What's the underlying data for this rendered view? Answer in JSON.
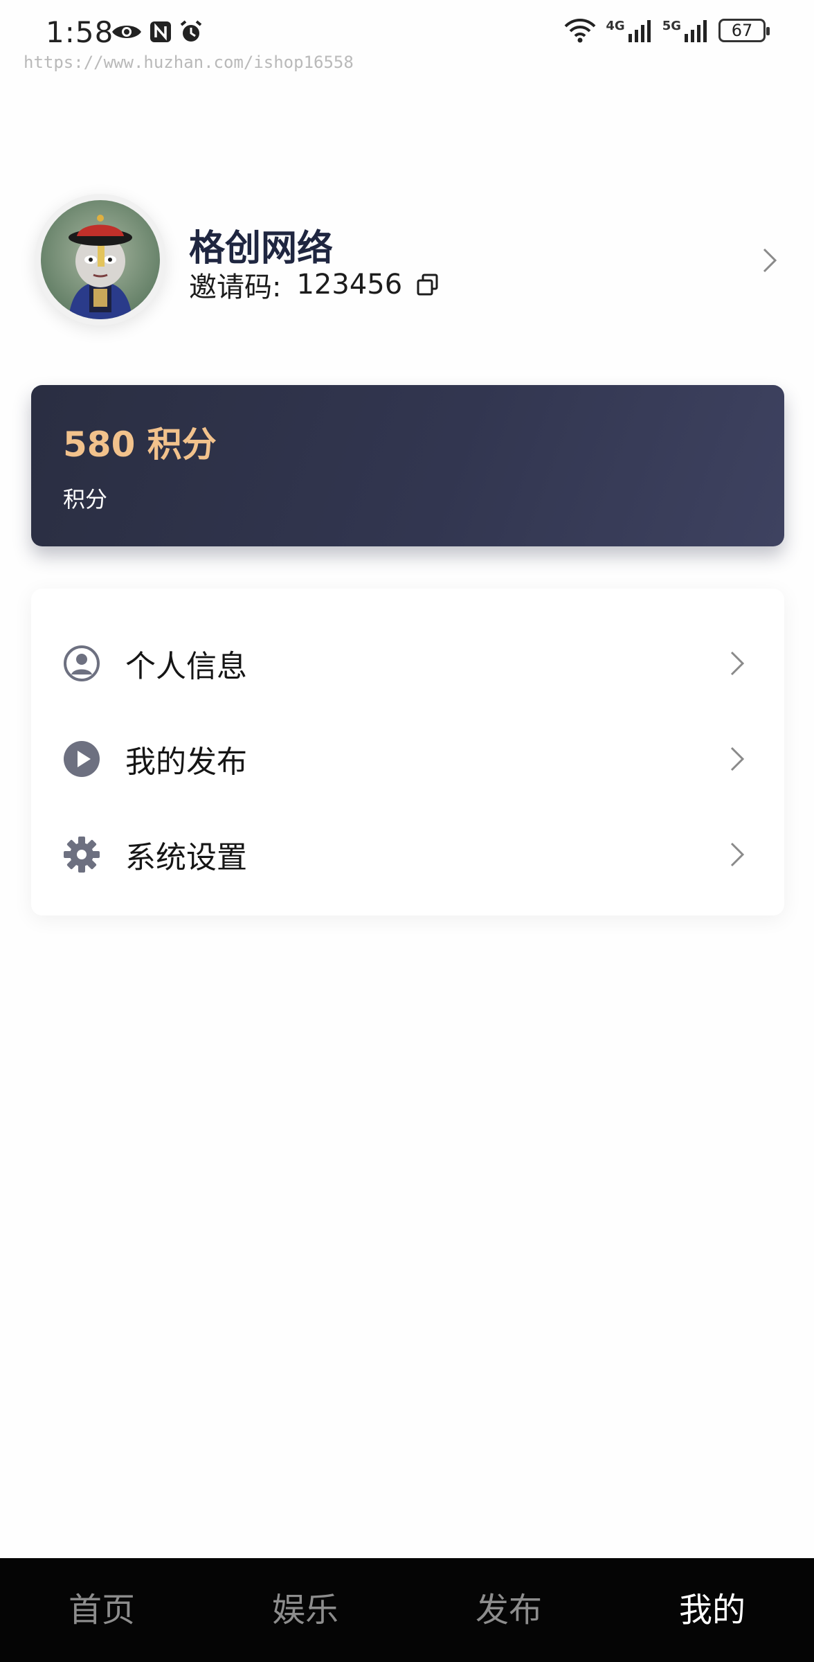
{
  "status_bar": {
    "time": "1:58",
    "net_4g": "4G",
    "net_5g": "5G",
    "battery": "67",
    "watermark": "https://www.huzhan.com/ishop16558",
    "icons": [
      "eye-icon",
      "nfc-icon",
      "alarm-icon",
      "wifi-icon",
      "signal-icon",
      "battery-icon"
    ]
  },
  "profile": {
    "name": "格创网络",
    "invite_label": "邀请码:",
    "invite_code": "123456",
    "avatar": "qing-zombie-avatar"
  },
  "points_card": {
    "value": "580 积分",
    "label": "积分",
    "value_color": "#f2c28c"
  },
  "menu": {
    "items": [
      {
        "label": "个人信息",
        "icon": "user-circle-icon"
      },
      {
        "label": "我的发布",
        "icon": "play-circle-icon"
      },
      {
        "label": "系统设置",
        "icon": "gear-icon"
      }
    ]
  },
  "tab_bar": {
    "tabs": [
      {
        "label": "首页"
      },
      {
        "label": "娱乐"
      },
      {
        "label": "发布"
      },
      {
        "label": "我的"
      }
    ],
    "active": "我的"
  }
}
